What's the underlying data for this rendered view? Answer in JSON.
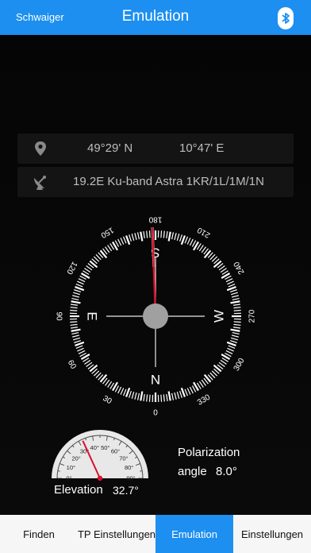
{
  "nav": {
    "back_label": "Schwaiger",
    "title": "Emulation"
  },
  "location": {
    "latitude": "49°29' N",
    "longitude": "10°47' E"
  },
  "satellite": {
    "name": "19.2E Ku-band Astra 1KR/1L/1M/1N"
  },
  "compass": {
    "cardinals": {
      "north": "N",
      "south": "S",
      "east": "E",
      "west": "W"
    },
    "degree_labels": [
      "0",
      "30",
      "60",
      "90",
      "120",
      "150",
      "180",
      "210",
      "240",
      "270",
      "300",
      "330"
    ],
    "needle_heading_deg": 178,
    "colors": {
      "needle": "#d8102a",
      "dial": "#ffffff",
      "hub": "#a0a0a0"
    }
  },
  "elevation": {
    "label": "Elevation",
    "value_text": "32.7°",
    "value_deg": 32.7,
    "scale_labels": [
      "0°",
      "10°",
      "20°",
      "30°",
      "40°",
      "50°",
      "60°",
      "70°",
      "80°",
      "90°"
    ]
  },
  "polarization": {
    "label": "Polarization",
    "angle_label": "angle",
    "angle_value": "8.0°"
  },
  "tabs": [
    {
      "label": "Finden",
      "active": false
    },
    {
      "label": "TP Einstellungen",
      "active": false
    },
    {
      "label": "Emulation",
      "active": true
    },
    {
      "label": "Einstellungen",
      "active": false
    }
  ],
  "colors": {
    "accent": "#1c8ff0",
    "needle": "#d8102a",
    "background": "#000000"
  },
  "icons": {
    "location": "location-pin-icon",
    "satellite": "satellite-dish-icon",
    "bluetooth": "bluetooth-icon"
  }
}
